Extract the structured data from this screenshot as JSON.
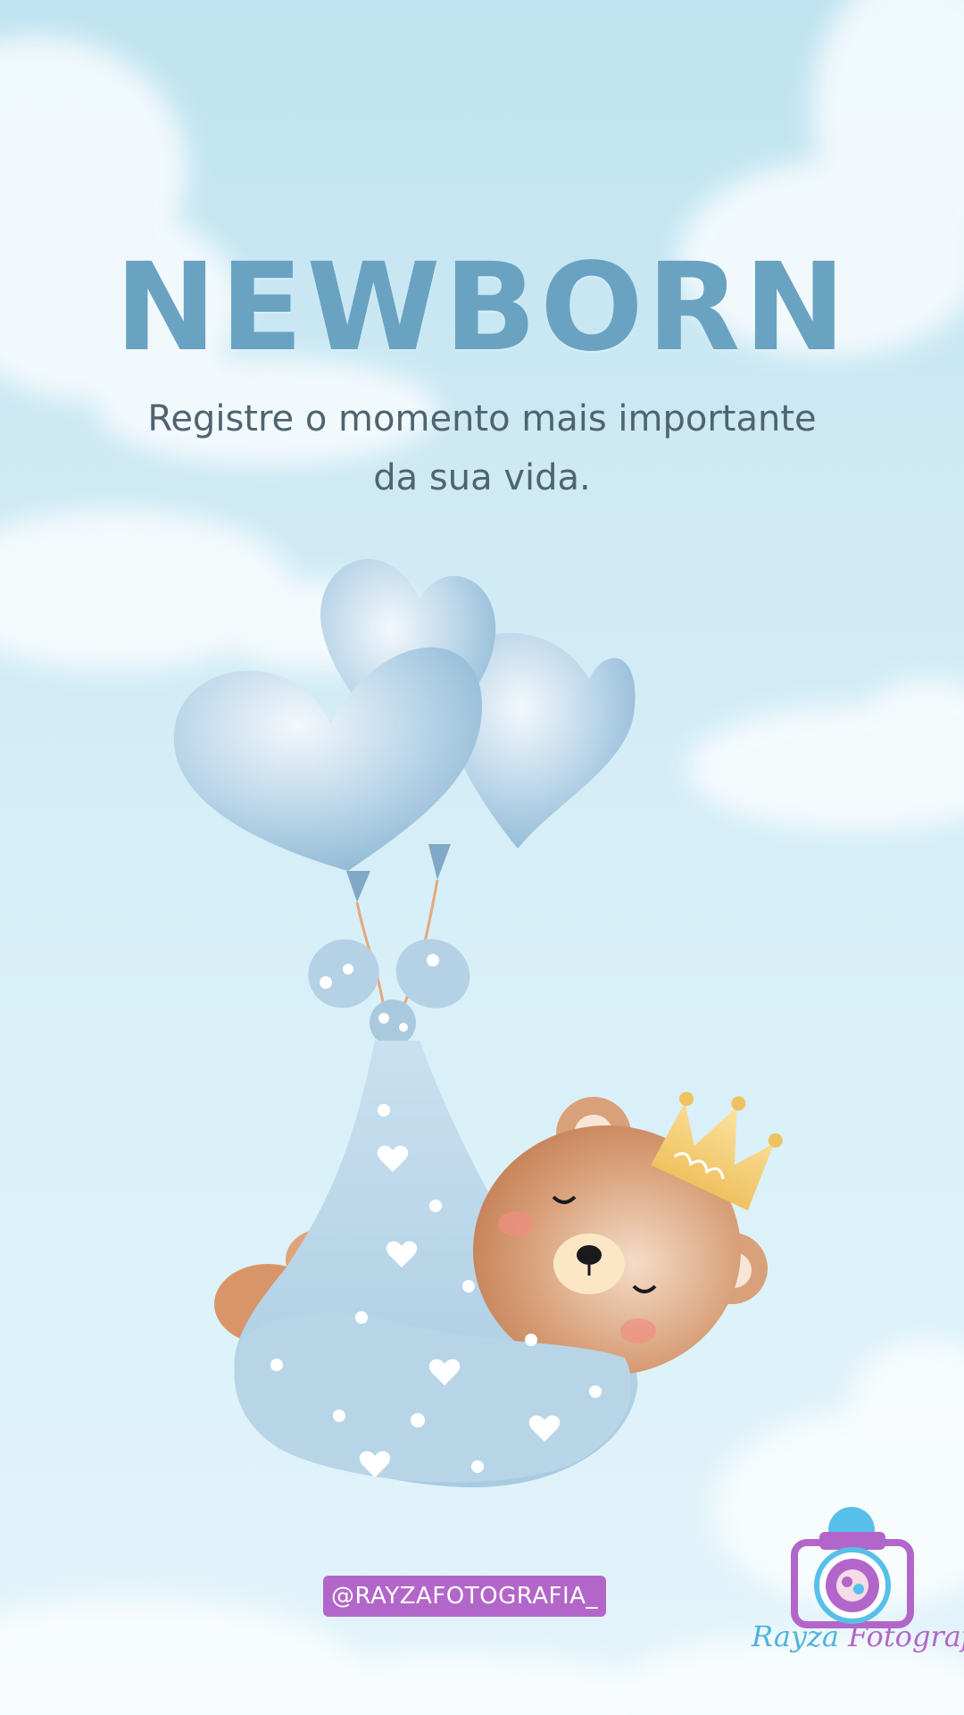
{
  "title": "NEWBORN",
  "subtitle_line1": "Registre o momento mais importante",
  "subtitle_line2": "da sua vida.",
  "handle": "@RAYZAFOTOGRAFIA_",
  "logo": {
    "word1": "Rayza",
    "word2": "Fotografia",
    "icon": "camera-baby-icon"
  },
  "illustration": {
    "subject": "teddy-bear-in-bundle",
    "balloons": "heart-balloons-icon",
    "crown": "crown-icon"
  },
  "colors": {
    "title": "#6aa3c2",
    "subtitle": "#4f6470",
    "badge": "#b366c9",
    "logo_blue": "#4fb3dd",
    "logo_purple": "#b366c9"
  }
}
